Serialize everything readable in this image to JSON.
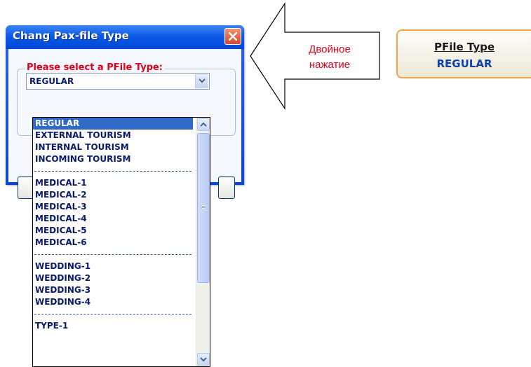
{
  "dialog": {
    "title": "Chang Pax-file Type",
    "group_label": "Please select a PFile Type:",
    "combo_value": "REGULAR"
  },
  "dropdown": {
    "selected": "REGULAR",
    "items": [
      {
        "label": "REGULAR"
      },
      {
        "label": "EXTERNAL TOURISM"
      },
      {
        "label": "INTERNAL TOURISM"
      },
      {
        "label": "INCOMING TOURISM"
      },
      {
        "label": "MEDICAL-1"
      },
      {
        "label": "MEDICAL-2"
      },
      {
        "label": "MEDICAL-3"
      },
      {
        "label": "MEDICAL-4"
      },
      {
        "label": "MEDICAL-5"
      },
      {
        "label": "MEDICAL-6"
      },
      {
        "label": "WEDDING-1"
      },
      {
        "label": "WEDDING-2"
      },
      {
        "label": "WEDDING-3"
      },
      {
        "label": "WEDDING-4"
      },
      {
        "label": "TYPE-1"
      }
    ]
  },
  "callout": {
    "line1": "Двойное",
    "line2": "нажатие"
  },
  "pfile_cell": {
    "header": "PFile Type",
    "value": "REGULAR"
  },
  "colors": {
    "titlebar": "#0c5ae6",
    "selection": "#316ac5",
    "callout_text": "#e0001b",
    "pfile_border": "#f6a24a"
  }
}
